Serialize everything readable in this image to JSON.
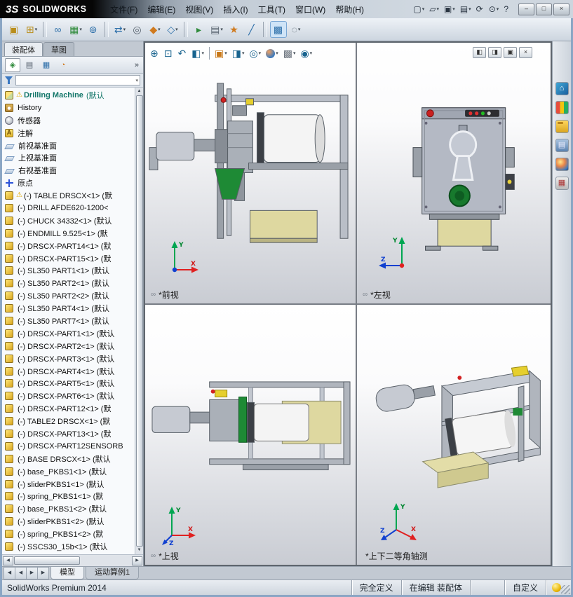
{
  "colors": {
    "accent_green": "#1e8a35",
    "khaki": "#ded8a0",
    "warning_yellow": "#e0a800",
    "axis_x": "#d01818",
    "axis_y": "#00862f",
    "axis_z": "#1040d0"
  },
  "titlebar": {
    "brand_mark": "3S",
    "brand": "SOLIDWORKS",
    "menus": [
      "文件(F)",
      "编辑(E)",
      "视图(V)",
      "插入(I)",
      "工具(T)",
      "窗口(W)",
      "帮助(H)"
    ],
    "quick_icons": [
      {
        "name": "new-document-button",
        "glyph": "▢",
        "dd": "▾",
        "inter": "true"
      },
      {
        "name": "open-document-button",
        "glyph": "▱",
        "dd": "▾",
        "inter": "true"
      },
      {
        "name": "save-button",
        "glyph": "▣",
        "dd": "▾",
        "inter": "true"
      },
      {
        "name": "print-button",
        "glyph": "▤",
        "dd": "▾",
        "inter": "true"
      },
      {
        "name": "rebuild-button",
        "glyph": "⟳",
        "dd": "",
        "inter": "true"
      },
      {
        "name": "options-button",
        "glyph": "⊙",
        "dd": "▾",
        "inter": "true"
      },
      {
        "name": "help-button",
        "glyph": "?",
        "dd": "",
        "inter": "true"
      }
    ],
    "window_buttons": [
      {
        "name": "minimize-button",
        "glyph": "–"
      },
      {
        "name": "maximize-button",
        "glyph": "□"
      },
      {
        "name": "close-button",
        "glyph": "×"
      }
    ]
  },
  "toolbar": {
    "items": [
      {
        "name": "edit-component-button",
        "glyph": "▣",
        "cls": "c-y",
        "dd": "",
        "inter": "true"
      },
      {
        "name": "insert-components-button",
        "glyph": "⊞",
        "cls": "c-y",
        "dd": "▾",
        "inter": "true"
      },
      {
        "name": "separator",
        "glyph": "",
        "cls": "sep",
        "dd": "",
        "inter": "false"
      },
      {
        "name": "mate-button",
        "glyph": "∞",
        "cls": "c-b",
        "dd": "",
        "inter": "true"
      },
      {
        "name": "linear-component-pattern-button",
        "glyph": "▦",
        "cls": "c-g",
        "dd": "▾",
        "inter": "true"
      },
      {
        "name": "smart-fasteners-button",
        "glyph": "⊚",
        "cls": "c-b",
        "dd": "",
        "inter": "true"
      },
      {
        "name": "separator",
        "glyph": "",
        "cls": "sep",
        "dd": "",
        "inter": "false"
      },
      {
        "name": "move-component-button",
        "glyph": "⇄",
        "cls": "c-b",
        "dd": "▾",
        "inter": "true"
      },
      {
        "name": "show-hidden-components-button",
        "glyph": "◎",
        "cls": "c-k",
        "dd": "",
        "inter": "true"
      },
      {
        "name": "assembly-features-button",
        "glyph": "◆",
        "cls": "c-o",
        "dd": "▾",
        "inter": "true"
      },
      {
        "name": "reference-geometry-button",
        "glyph": "◇",
        "cls": "c-b",
        "dd": "▾",
        "inter": "true"
      },
      {
        "name": "separator",
        "glyph": "",
        "cls": "sep",
        "dd": "",
        "inter": "false"
      },
      {
        "name": "new-motion-study-button",
        "glyph": "▸",
        "cls": "c-g",
        "dd": "",
        "inter": "true"
      },
      {
        "name": "bill-of-materials-button",
        "glyph": "▤",
        "cls": "c-k",
        "dd": "▾",
        "inter": "true"
      },
      {
        "name": "exploded-view-button",
        "glyph": "★",
        "cls": "c-o",
        "dd": "",
        "inter": "true"
      },
      {
        "name": "explode-line-sketch-button",
        "glyph": "╱",
        "cls": "c-b",
        "dd": "",
        "inter": "true"
      },
      {
        "name": "separator",
        "glyph": "",
        "cls": "sep",
        "dd": "",
        "inter": "false"
      },
      {
        "name": "interference-detection-button",
        "glyph": "▩",
        "cls": "c-b active",
        "dd": "",
        "inter": "true"
      },
      {
        "name": "isolate-button",
        "glyph": "◌",
        "c­ls": "c-k",
        "cls": "c-k",
        "dd": "▾",
        "inter": "true"
      }
    ]
  },
  "left_panel": {
    "tabs": [
      {
        "name": "tab-assembly",
        "label": "装配体",
        "cls": "active"
      },
      {
        "name": "tab-sketch",
        "label": "草图",
        "cls": ""
      }
    ],
    "manager_tabs": [
      {
        "name": "featuremanager-tab",
        "glyph": "◈",
        "cls": "active c-g",
        "inter": "true"
      },
      {
        "name": "propertymanager-tab",
        "glyph": "▤",
        "cls": "c-k",
        "inter": "true"
      },
      {
        "name": "configurationmanager-tab",
        "glyph": "▦",
        "cls": "c-b",
        "inter": "true"
      },
      {
        "name": "displaymanager-tab",
        "glyph": "◔",
        "cls": "c-o",
        "inter": "true"
      }
    ],
    "overflow": "»",
    "filter_caret": "▾",
    "scrollbars": {
      "up": "▲",
      "down": "▼",
      "left": "◀",
      "right": "▶"
    },
    "tree": {
      "root": {
        "label": "Drilling Machine",
        "suffix": "(默认",
        "badge": "⚠"
      },
      "items": [
        {
          "icon": "history",
          "label": "History"
        },
        {
          "icon": "sensor",
          "label": "传感器"
        },
        {
          "icon": "ann",
          "label": "注解"
        },
        {
          "icon": "plane",
          "label": "前视基准面"
        },
        {
          "icon": "plane",
          "label": "上视基准面"
        },
        {
          "icon": "plane",
          "label": "右视基准面"
        },
        {
          "icon": "origin",
          "label": "原点"
        },
        {
          "icon": "part",
          "badge": "⚠",
          "label": "(-) TABLE DRSCX<1> (默"
        },
        {
          "icon": "part",
          "label": "(-) DRILL AFDE620-1200<"
        },
        {
          "icon": "part",
          "label": "(-) CHUCK 34332<1> (默认"
        },
        {
          "icon": "part",
          "label": "(-) ENDMILL 9.525<1> (默"
        },
        {
          "icon": "part",
          "label": "(-) DRSCX-PART14<1> (默"
        },
        {
          "icon": "part",
          "label": "(-) DRSCX-PART15<1> (默"
        },
        {
          "icon": "part",
          "label": "(-) SL350 PART1<1> (默认"
        },
        {
          "icon": "part",
          "label": "(-) SL350 PART2<1> (默认"
        },
        {
          "icon": "part",
          "label": "(-) SL350 PART2<2> (默认"
        },
        {
          "icon": "part",
          "label": "(-) SL350 PART4<1> (默认"
        },
        {
          "icon": "part",
          "label": "(-) SL350 PART7<1> (默认"
        },
        {
          "icon": "part",
          "label": "(-) DRSCX-PART1<1> (默认"
        },
        {
          "icon": "part",
          "label": "(-) DRSCX-PART2<1> (默认"
        },
        {
          "icon": "part",
          "label": "(-) DRSCX-PART3<1> (默认"
        },
        {
          "icon": "part",
          "label": "(-) DRSCX-PART4<1> (默认"
        },
        {
          "icon": "part",
          "label": "(-) DRSCX-PART5<1> (默认"
        },
        {
          "icon": "part",
          "label": "(-) DRSCX-PART6<1> (默认"
        },
        {
          "icon": "part",
          "label": "(-) DRSCX-PART12<1> (默"
        },
        {
          "icon": "part",
          "label": "(-) TABLE2 DRSCX<1> (默"
        },
        {
          "icon": "part",
          "label": "(-) DRSCX-PART13<1> (默"
        },
        {
          "icon": "part",
          "label": "(-) DRSCX-PART12SENSORB"
        },
        {
          "icon": "part",
          "label": "(-) BASE DRSCX<1> (默认"
        },
        {
          "icon": "part",
          "label": "(-) base_PKBS1<1> (默认"
        },
        {
          "icon": "part",
          "label": "(-) sliderPKBS1<1> (默认"
        },
        {
          "icon": "part",
          "label": "(-) spring_PKBS1<1> (默"
        },
        {
          "icon": "part",
          "label": "(-) base_PKBS1<2> (默认"
        },
        {
          "icon": "part",
          "label": "(-) sliderPKBS1<2> (默认"
        },
        {
          "icon": "part",
          "label": "(-) spring_PKBS1<2> (默"
        },
        {
          "icon": "part",
          "label": "(-) SSCS30_15b<1> (默认"
        }
      ]
    }
  },
  "viewport": {
    "hud": [
      {
        "name": "zoom-to-fit-button",
        "glyph": "⊕",
        "cls": "",
        "dd": "",
        "inter": "true"
      },
      {
        "name": "zoom-to-area-button",
        "glyph": "⊡",
        "cls": "",
        "dd": "",
        "inter": "true"
      },
      {
        "name": "previous-view-button",
        "glyph": "↶",
        "cls": "",
        "dd": "",
        "inter": "true"
      },
      {
        "name": "section-view-button",
        "glyph": "◧",
        "cls": "",
        "dd": "▾",
        "inter": "true"
      },
      {
        "name": "separator",
        "glyph": "",
        "cls": "sep",
        "dd": "",
        "inter": "false"
      },
      {
        "name": "view-orientation-button",
        "glyph": "▣",
        "cls": "c-cube",
        "dd": "▾",
        "inter": "true"
      },
      {
        "name": "display-style-button",
        "glyph": "◨",
        "cls": "",
        "dd": "▾",
        "inter": "true"
      },
      {
        "name": "hide-show-items-button",
        "glyph": "◎",
        "cls": "",
        "dd": "▾",
        "inter": "true"
      },
      {
        "name": "edit-appearance-button",
        "glyph": "●",
        "cls": "c-ball",
        "dd": "▾",
        "inter": "true"
      },
      {
        "name": "apply-scene-button",
        "glyph": "▩",
        "cls": "c-scene",
        "dd": "▾",
        "inter": "true"
      },
      {
        "name": "view-settings-button",
        "glyph": "◉",
        "cls": "",
        "dd": "▾",
        "inter": "true"
      }
    ],
    "pane_buttons": [
      {
        "name": "pane-split-left-button",
        "glyph": "◧"
      },
      {
        "name": "pane-split-right-button",
        "glyph": "◨"
      },
      {
        "name": "restore-pane-button",
        "glyph": "▣"
      },
      {
        "name": "close-pane-button",
        "glyph": "×"
      }
    ],
    "views": [
      {
        "name": "front",
        "label": "*前视",
        "icon": "∞",
        "axes": {
          "v": "Y",
          "h": "X"
        }
      },
      {
        "name": "left",
        "label": "*左视",
        "icon": "∞",
        "axes": {
          "v": "Y",
          "h": "Z"
        }
      },
      {
        "name": "top",
        "label": "*上视",
        "icon": "∞",
        "axes": {
          "v": "Y",
          "h": "X",
          "d": "Z"
        }
      },
      {
        "name": "isometric",
        "label": "*上下二等角轴测",
        "icon": "",
        "axes": {
          "v": "Y",
          "h": "X",
          "d": "Z"
        }
      }
    ]
  },
  "task_pane": {
    "items": [
      {
        "name": "solidworks-resources-icon",
        "cls": "tp-res",
        "glyph": "⌂"
      },
      {
        "name": "view-palette-icon",
        "cls": "tp-pal",
        "glyph": ""
      },
      {
        "name": "design-library-icon",
        "cls": "tp-lib",
        "glyph": ""
      },
      {
        "name": "file-explorer-icon",
        "cls": "tp-exp",
        "glyph": "▤"
      },
      {
        "name": "appearances-icon",
        "cls": "tp-app",
        "glyph": ""
      },
      {
        "name": "custom-properties-icon",
        "cls": "tp-prop",
        "glyph": "▦"
      }
    ]
  },
  "bottom_tabs": {
    "nav": [
      {
        "name": "tab-scroll-first-button",
        "glyph": "◀"
      },
      {
        "name": "tab-scroll-prev-button",
        "glyph": "◀"
      },
      {
        "name": "tab-scroll-next-button",
        "glyph": "▶"
      },
      {
        "name": "tab-scroll-last-button",
        "glyph": "▶"
      }
    ],
    "tabs": [
      {
        "name": "tab-model",
        "label": "模型",
        "cls": "active"
      },
      {
        "name": "tab-motion-study",
        "label": "运动算例1",
        "cls": ""
      }
    ]
  },
  "statusbar": {
    "app_name": "SolidWorks Premium 2014",
    "segments": [
      {
        "name": "definition-status",
        "label": "完全定义",
        "inter": "false"
      },
      {
        "name": "editing-status",
        "label": "在编辑 装配体",
        "inter": "false"
      },
      {
        "name": "status-spacer",
        "label": "",
        "inter": "false"
      },
      {
        "name": "custom-toolbar-menu",
        "label": "自定义",
        "inter": "true"
      }
    ]
  }
}
